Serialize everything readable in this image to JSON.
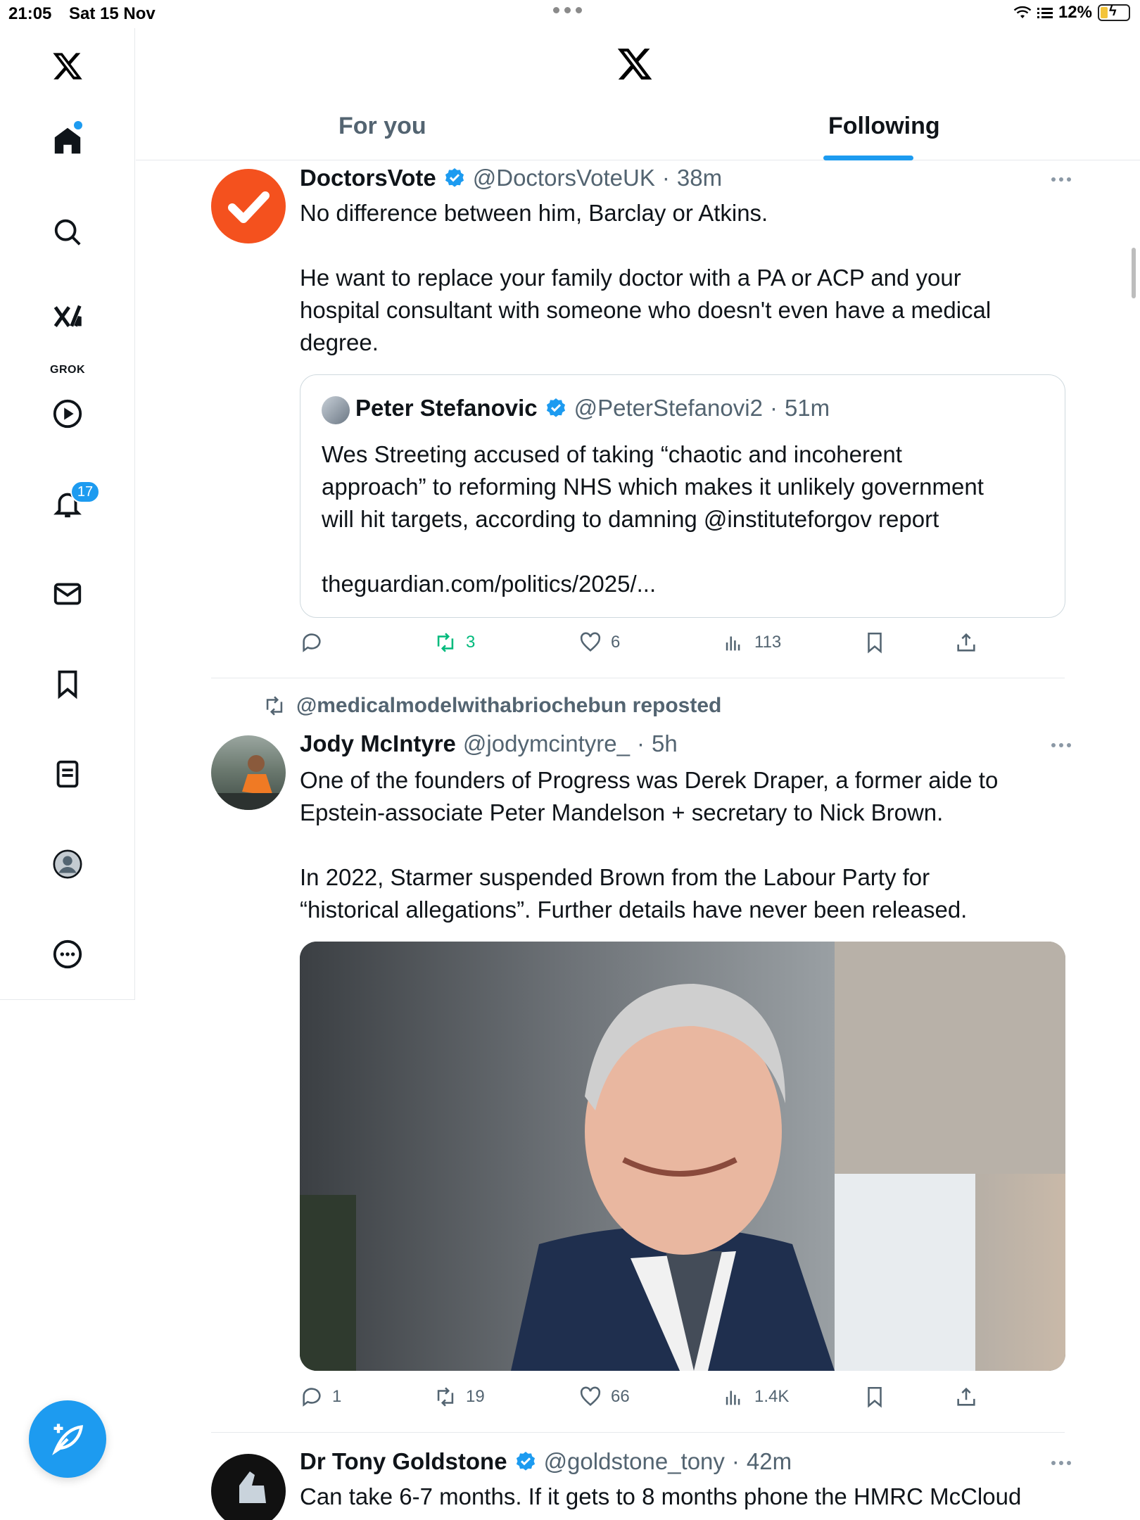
{
  "status_bar": {
    "time": "21:05",
    "date": "Sat 15 Nov",
    "battery": "12%"
  },
  "sidebar": {
    "items": [
      {
        "name": "home",
        "icon": "home-icon"
      },
      {
        "name": "search",
        "icon": "search-icon"
      },
      {
        "name": "grok",
        "icon": "grok-icon",
        "label": "GROK"
      },
      {
        "name": "video",
        "icon": "play-icon"
      },
      {
        "name": "notifications",
        "icon": "bell-icon",
        "badge": "17"
      },
      {
        "name": "messages",
        "icon": "mail-icon"
      },
      {
        "name": "bookmarks",
        "icon": "bookmark-icon"
      },
      {
        "name": "lists",
        "icon": "list-icon"
      },
      {
        "name": "profile",
        "icon": "profile-icon"
      },
      {
        "name": "more",
        "icon": "more-circle-icon"
      }
    ]
  },
  "header": {
    "tabs": [
      {
        "label": "For you",
        "active": false
      },
      {
        "label": "Following",
        "active": true
      }
    ]
  },
  "colors": {
    "accent": "#1d9bf0",
    "text": "#0f1419",
    "muted": "#536471",
    "repost": "#00ba7c",
    "doctorsvote_avatar": "#f4511e"
  },
  "tweets": [
    {
      "name": "DoctorsVote",
      "verified": true,
      "handle": "@DoctorsVoteUK",
      "dot": "·",
      "time": "38m",
      "text": [
        "No difference between him, Barclay or Atkins.",
        "",
        "He want to replace your family doctor with a PA or ACP and your",
        "hospital consultant with someone who doesn't even have a medical",
        "degree."
      ],
      "quote": {
        "name": "Peter Stefanovic",
        "verified": true,
        "handle": "@PeterStefanovi2",
        "dot": "·",
        "time": "51m",
        "text": [
          "Wes Streeting accused of taking “chaotic and incoherent",
          "approach” to reforming NHS which makes it unlikely government",
          "will hit targets, according to damning @instituteforgov report",
          "",
          "theguardian.com/politics/2025/..."
        ]
      },
      "actions": {
        "replies": "",
        "reposts": "3",
        "likes": "6",
        "views": "113"
      }
    },
    {
      "repost_by": "@medicalmodelwithabriochebun reposted",
      "name": "Jody McIntyre",
      "verified": false,
      "handle": "@jodymcintyre_",
      "dot": "·",
      "time": "5h",
      "text": [
        "One of the founders of Progress was Derek Draper, a former aide to",
        "Epstein-associate Peter Mandelson + secretary to Nick Brown.",
        "",
        "In 2022, Starmer suspended Brown from the Labour Party for",
        "“historical allegations”. Further details have never been released."
      ],
      "actions": {
        "replies": "1",
        "reposts": "19",
        "likes": "66",
        "views": "1.4K"
      }
    },
    {
      "name": "Dr Tony Goldstone",
      "verified": true,
      "handle": "@goldstone_tony",
      "dot": "·",
      "time": "42m",
      "text": [
        "Can take 6-7 months. If it gets to 8 months phone the HMRC McCloud"
      ]
    }
  ]
}
